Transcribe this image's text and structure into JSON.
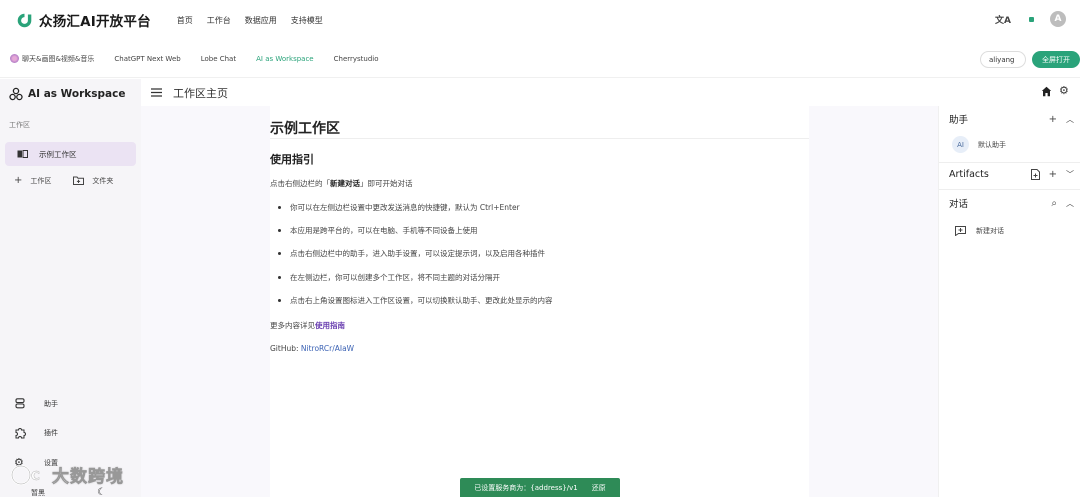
{
  "header": {
    "brand_name": "众扬汇AI开放平台",
    "nav": [
      "首页",
      "工作台",
      "数据应用",
      "支持模型"
    ],
    "translate_icon": "translate-icon",
    "avatar_letter": "A"
  },
  "tabs": {
    "items": [
      "聊天&画图&视频&音乐",
      "ChatGPT Next Web",
      "Lobe Chat",
      "AI as Workspace",
      "Cherrystudio"
    ],
    "active_index": 3,
    "user": "aliyang",
    "fullscreen": "全屏打开"
  },
  "sidebar": {
    "title": "AI as Workspace",
    "section": "工作区",
    "active_workspace": "示例工作区",
    "add_workspace": "工作区",
    "add_folder": "文件夹",
    "bottom": {
      "assistant": "助手",
      "plugins": "插件",
      "settings": "设置",
      "theme": "暂黑"
    }
  },
  "main": {
    "header_title": "工作区主页",
    "h1": "示例工作区",
    "h2": "使用指引",
    "intro_prefix": "点击右侧边栏的「",
    "intro_bold": "新建对话",
    "intro_suffix": "」即可开始对话",
    "bullets": [
      "你可以在左侧边栏设置中更改发送消息的快捷键，默认为 Ctrl+Enter",
      "本应用是跨平台的，可以在电脑、手机等不同设备上使用",
      "点击右侧边栏中的助手，进入助手设置，可以设定提示词，以及启用各种插件",
      "在左侧边栏，你可以创建多个工作区，将不同主题的对话分隔开",
      "点击右上角设置图标进入工作区设置，可以切换默认助手、更改此处显示的内容"
    ],
    "more_prefix": "更多内容详见",
    "more_link": "使用指南",
    "github_prefix": "GitHub: ",
    "github_link": "NitroRCr/AIaW"
  },
  "rightbar": {
    "assistant_title": "助手",
    "default_assistant": "默认助手",
    "ai_badge": "AI",
    "artifacts_title": "Artifacts",
    "dialog_title": "对话",
    "new_dialog": "新建对话"
  },
  "toast": {
    "message": "已设置服务商为：{address}/v1",
    "action": "还原"
  },
  "watermark": {
    "text": "大数跨境"
  },
  "colors": {
    "accent": "#2aa37a",
    "sidebar_bg": "#f6f5f8",
    "active_item": "#ebe3f3",
    "toast_bg": "#2e8b57",
    "link": "#6a3fb0"
  }
}
